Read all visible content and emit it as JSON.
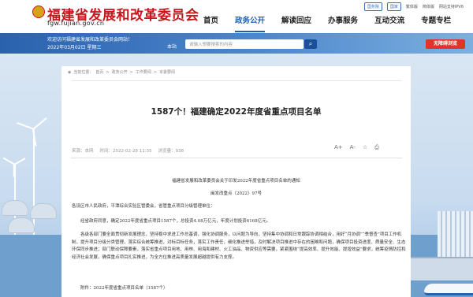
{
  "header": {
    "logo_title": "福建省发展和改革委员会",
    "logo_url": "fgw.fujian.gov.cn",
    "top_links": [
      "国务院",
      "国家",
      "繁体版",
      "简体版",
      "网站支持IPV6"
    ]
  },
  "nav": [
    "首页",
    "政务公开",
    "解读回应",
    "办事服务",
    "互动交流",
    "专题专栏"
  ],
  "welcome": {
    "line1": "欢迎访问福建省发展和改革委员会网站！",
    "line2": "2022年03月02日 星期三"
  },
  "search": {
    "site_label": "本站",
    "placeholder": "请输入想要搜索的内容"
  },
  "accessible_label": "无障碍浏览",
  "breadcrumb": [
    "当前位置：",
    "首页",
    "政务公开",
    "工作要闻",
    "本委要闻"
  ],
  "article": {
    "title": "1587个！福建确定2022年度省重点项目名单",
    "source": "来源：本网",
    "time": "时间：2022-02-28 11:35",
    "views": "浏览量：938",
    "tools": [
      "A+",
      "A-",
      "☆",
      "⎙"
    ],
    "doc_title": "福建省发展和改革委员会关于印发2022年度省重点项目名单的通知",
    "doc_no": "闽发改重点〔2022〕97号",
    "addressee": "各设区市人民政府，平潭综合实验区管委会，省管重点项目分级管理单位：",
    "p1": "经省政府同意，确定2022年度省重点项目1587个，总投资4.08万亿元，年度计划投资6168亿元。",
    "p2": "各级各部门要全面贯彻新发展理念，坚持稳中求进工作总基调，强化协调服务，以问题为导向，坚持集中协调和日常跟踪协调相结合，用好“月协调”“季督查”项目工作机制，提升项目分级分类管理，落实综合统筹推进，对标目标任务，落实工作责任，细化推进举措，及时解决项目推进中存在的困难和问题，确保项目投资进度、质量安全、生态环保同步推进；部门联动保障要素，落实省重点项目用地、用林、用海和建材、火工油品、物资供应等需要，紧紧围绕“提高效率、提升效能、提增效益”要求，统筹疫情防控和经济社会发展，确保重点项目扎实推进，为全方位推进高质量发展超越提供有力支撑。",
    "p3": "附件：2022年度省重点项目名单（1587个）"
  }
}
